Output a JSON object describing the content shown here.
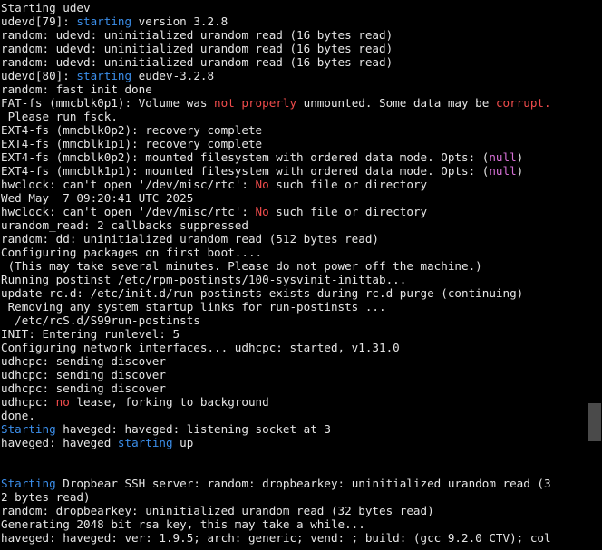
{
  "colors": {
    "background": "#000000",
    "default_text": "#e5e5e5",
    "blue": "#3b8eea",
    "red": "#f14c4c",
    "magenta": "#d670d6",
    "scroll_thumb": "#4a4a4a"
  },
  "terminal": {
    "lines": [
      [
        {
          "t": "Starting udev",
          "c": "default"
        }
      ],
      [
        {
          "t": "udevd[79]: ",
          "c": "default"
        },
        {
          "t": "starting",
          "c": "blue"
        },
        {
          "t": " version 3.2.8",
          "c": "default"
        }
      ],
      [
        {
          "t": "random: udevd: uninitialized urandom read (16 bytes read)",
          "c": "default"
        }
      ],
      [
        {
          "t": "random: udevd: uninitialized urandom read (16 bytes read)",
          "c": "default"
        }
      ],
      [
        {
          "t": "random: udevd: uninitialized urandom read (16 bytes read)",
          "c": "default"
        }
      ],
      [
        {
          "t": "udevd[80]: ",
          "c": "default"
        },
        {
          "t": "starting",
          "c": "blue"
        },
        {
          "t": " eudev-3.2.8",
          "c": "default"
        }
      ],
      [
        {
          "t": "random: fast init done",
          "c": "default"
        }
      ],
      [
        {
          "t": "FAT-fs (mmcblk0p1): Volume was ",
          "c": "default"
        },
        {
          "t": "not properly",
          "c": "red"
        },
        {
          "t": " unmounted. Some data may be ",
          "c": "default"
        },
        {
          "t": "corrupt.",
          "c": "red"
        }
      ],
      [
        {
          "t": " Please run fsck.",
          "c": "default"
        }
      ],
      [
        {
          "t": "EXT4-fs (mmcblk0p2): recovery complete",
          "c": "default"
        }
      ],
      [
        {
          "t": "EXT4-fs (mmcblk1p1): recovery complete",
          "c": "default"
        }
      ],
      [
        {
          "t": "EXT4-fs (mmcblk0p2): mounted filesystem with ordered data mode. Opts: (",
          "c": "default"
        },
        {
          "t": "null",
          "c": "magenta"
        },
        {
          "t": ")",
          "c": "default"
        }
      ],
      [
        {
          "t": "EXT4-fs (mmcblk1p1): mounted filesystem with ordered data mode. Opts: (",
          "c": "default"
        },
        {
          "t": "null",
          "c": "magenta"
        },
        {
          "t": ")",
          "c": "default"
        }
      ],
      [
        {
          "t": "hwclock: can't open '/dev/misc/rtc': ",
          "c": "default"
        },
        {
          "t": "No",
          "c": "red"
        },
        {
          "t": " such file or directory",
          "c": "default"
        }
      ],
      [
        {
          "t": "Wed May  7 09:20:41 UTC 2025",
          "c": "default"
        }
      ],
      [
        {
          "t": "hwclock: can't open '/dev/misc/rtc': ",
          "c": "default"
        },
        {
          "t": "No",
          "c": "red"
        },
        {
          "t": " such file or directory",
          "c": "default"
        }
      ],
      [
        {
          "t": "urandom_read: 2 callbacks suppressed",
          "c": "default"
        }
      ],
      [
        {
          "t": "random: dd: uninitialized urandom read (512 bytes read)",
          "c": "default"
        }
      ],
      [
        {
          "t": "Configuring packages on first boot....",
          "c": "default"
        }
      ],
      [
        {
          "t": " (This may take several minutes. Please do not power off the machine.)",
          "c": "default"
        }
      ],
      [
        {
          "t": "Running postinst /etc/rpm-postinsts/100-sysvinit-inittab...",
          "c": "default"
        }
      ],
      [
        {
          "t": "update-rc.d: /etc/init.d/run-postinsts exists during rc.d purge (continuing)",
          "c": "default"
        }
      ],
      [
        {
          "t": " Removing any system startup links for run-postinsts ...",
          "c": "default"
        }
      ],
      [
        {
          "t": "  /etc/rcS.d/S99run-postinsts",
          "c": "default"
        }
      ],
      [
        {
          "t": "INIT: Entering runlevel: 5",
          "c": "default"
        }
      ],
      [
        {
          "t": "Configuring network interfaces... udhcpc: started, v1.31.0",
          "c": "default"
        }
      ],
      [
        {
          "t": "udhcpc: sending discover",
          "c": "default"
        }
      ],
      [
        {
          "t": "udhcpc: sending discover",
          "c": "default"
        }
      ],
      [
        {
          "t": "udhcpc: sending discover",
          "c": "default"
        }
      ],
      [
        {
          "t": "udhcpc: ",
          "c": "default"
        },
        {
          "t": "no",
          "c": "red"
        },
        {
          "t": " lease, forking to background",
          "c": "default"
        }
      ],
      [
        {
          "t": "done.",
          "c": "default"
        }
      ],
      [
        {
          "t": "Starting",
          "c": "blue"
        },
        {
          "t": " haveged: haveged: listening socket at 3",
          "c": "default"
        }
      ],
      [
        {
          "t": "haveged: haveged ",
          "c": "default"
        },
        {
          "t": "starting",
          "c": "blue"
        },
        {
          "t": " up",
          "c": "default"
        }
      ],
      [
        {
          "t": "",
          "c": "default"
        }
      ],
      [
        {
          "t": "",
          "c": "default"
        }
      ],
      [
        {
          "t": "Starting",
          "c": "blue"
        },
        {
          "t": " Dropbear SSH server: random: dropbearkey: uninitialized urandom read (3",
          "c": "default"
        }
      ],
      [
        {
          "t": "2 bytes read)",
          "c": "default"
        }
      ],
      [
        {
          "t": "random: dropbearkey: uninitialized urandom read (32 bytes read)",
          "c": "default"
        }
      ],
      [
        {
          "t": "Generating 2048 bit rsa key, this may take a while...",
          "c": "default"
        }
      ],
      [
        {
          "t": "haveged: haveged: ver: 1.9.5; arch: generic; vend: ; build: (gcc 9.2.0 CTV); col",
          "c": "default"
        }
      ]
    ]
  }
}
